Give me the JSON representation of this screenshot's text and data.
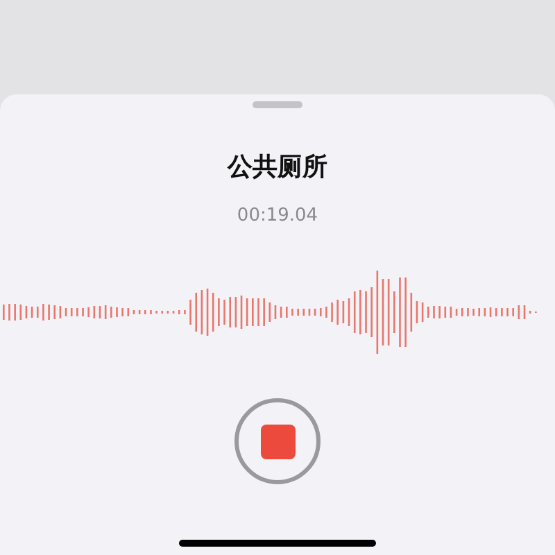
{
  "recording": {
    "title": "公共厕所",
    "elapsed": "00:19.04"
  }
}
